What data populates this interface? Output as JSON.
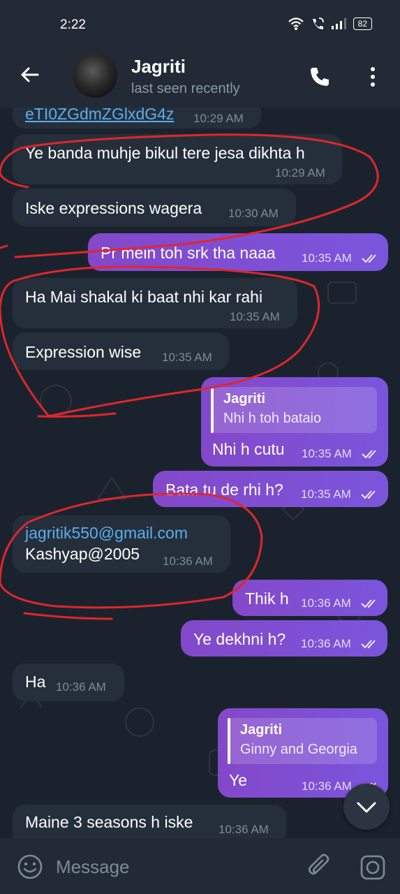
{
  "status_bar": {
    "time": "2:22",
    "battery": "82"
  },
  "header": {
    "name": "Jagriti",
    "status": "last seen recently"
  },
  "messages": [
    {
      "dir": "in",
      "text": "eTI0ZGdmZGlxdG4z",
      "time": "10:29 AM"
    },
    {
      "dir": "in",
      "text": "Ye banda muhje bikul tere jesa dikhta h",
      "time": "10:29 AM"
    },
    {
      "dir": "in",
      "text": "Iske expressions wagera",
      "time": "10:30 AM"
    },
    {
      "dir": "out",
      "text": "Pr mein toh srk tha naaa",
      "time": "10:35 AM"
    },
    {
      "dir": "in",
      "text": "Ha Mai shakal ki baat nhi kar rahi",
      "time": "10:35 AM"
    },
    {
      "dir": "in",
      "text": "Expression wise",
      "time": "10:35 AM"
    },
    {
      "dir": "out",
      "reply_name": "Jagriti",
      "reply_text": "Nhi h toh bataio",
      "text": "Nhi h cutu",
      "time": "10:35 AM"
    },
    {
      "dir": "out",
      "text": "Bata tu de rhi h?",
      "time": "10:35 AM"
    },
    {
      "dir": "in",
      "email": "jagritik550@gmail.com",
      "text": "Kashyap@2005",
      "time": "10:36 AM"
    },
    {
      "dir": "out",
      "text": "Thik h",
      "time": "10:36 AM"
    },
    {
      "dir": "out",
      "text": "Ye dekhni h?",
      "time": "10:36 AM"
    },
    {
      "dir": "in",
      "text": "Ha",
      "time": "10:36 AM"
    },
    {
      "dir": "out",
      "reply_name": "Jagriti",
      "reply_text": "Ginny and Georgia",
      "text": "Ye",
      "time": "10:36 AM"
    },
    {
      "dir": "in",
      "text": "Maine 3 seasons h iske",
      "time": "10:36 AM"
    }
  ],
  "input": {
    "placeholder": "Message"
  },
  "colors": {
    "outgoing": "#7b52d8",
    "incoming": "#252f3b",
    "background": "#1a232d",
    "annotation": "#e0262c",
    "link": "#5aaef0"
  },
  "icons": [
    "wifi-icon",
    "call-status-icon",
    "signal-icon",
    "battery-icon",
    "back-arrow-icon",
    "phone-icon",
    "more-vert-icon",
    "double-check-icon",
    "chevron-down-icon",
    "emoji-icon",
    "attach-icon",
    "camera-icon"
  ]
}
